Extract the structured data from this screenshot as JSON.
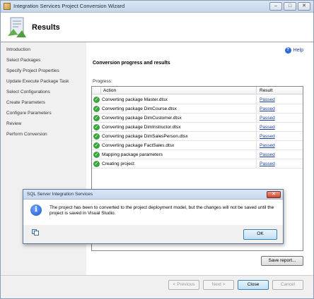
{
  "window": {
    "title": "Integration Services Project Conversion Wizard",
    "controls": [
      "–",
      "□",
      "✕"
    ]
  },
  "header": {
    "title": "Results"
  },
  "sidebar": {
    "items": [
      {
        "label": "Introduction"
      },
      {
        "label": "Select Packages"
      },
      {
        "label": "Specify Project Properties"
      },
      {
        "label": "Update Execute Package Task"
      },
      {
        "label": "Select Configurations"
      },
      {
        "label": "Create Parameters"
      },
      {
        "label": "Configure Parameters"
      },
      {
        "label": "Review"
      },
      {
        "label": "Perform Conversion"
      }
    ]
  },
  "main": {
    "help_label": "Help",
    "section_title": "Conversion progress and results",
    "progress_label": "Progress:",
    "table": {
      "headers": {
        "action": "Action",
        "result": "Result"
      },
      "rows": [
        {
          "action": "Converting package Master.dtsx",
          "result": "Passed"
        },
        {
          "action": "Converting package DimCourse.dtsx",
          "result": "Passed"
        },
        {
          "action": "Converting package DimCustomer.dtsx",
          "result": "Passed"
        },
        {
          "action": "Converting package DimInstructor.dtsx",
          "result": "Passed"
        },
        {
          "action": "Converting package DimSalesPerson.dtsx",
          "result": "Passed"
        },
        {
          "action": "Converting package FactSales.dtsx",
          "result": "Passed"
        },
        {
          "action": "Mapping package parameters",
          "result": "Passed"
        },
        {
          "action": "Creating project",
          "result": "Passed"
        }
      ]
    },
    "save_report_label": "Save report..."
  },
  "footer": {
    "previous_label": "< Previous",
    "next_label": "Next >",
    "close_label": "Close",
    "cancel_label": "Cancel"
  },
  "dialog": {
    "title": "SQL Server Integration Services",
    "message": "The project has been to converted to the project deployment model, but the changes will not be saved until the project is saved in Visual Studio.",
    "ok_label": "OK",
    "close_glyph": "✕",
    "icon_glyph": "i"
  },
  "colors": {
    "link": "#1a3e99",
    "success": "#3aa53a",
    "info": "#1a55c9"
  }
}
